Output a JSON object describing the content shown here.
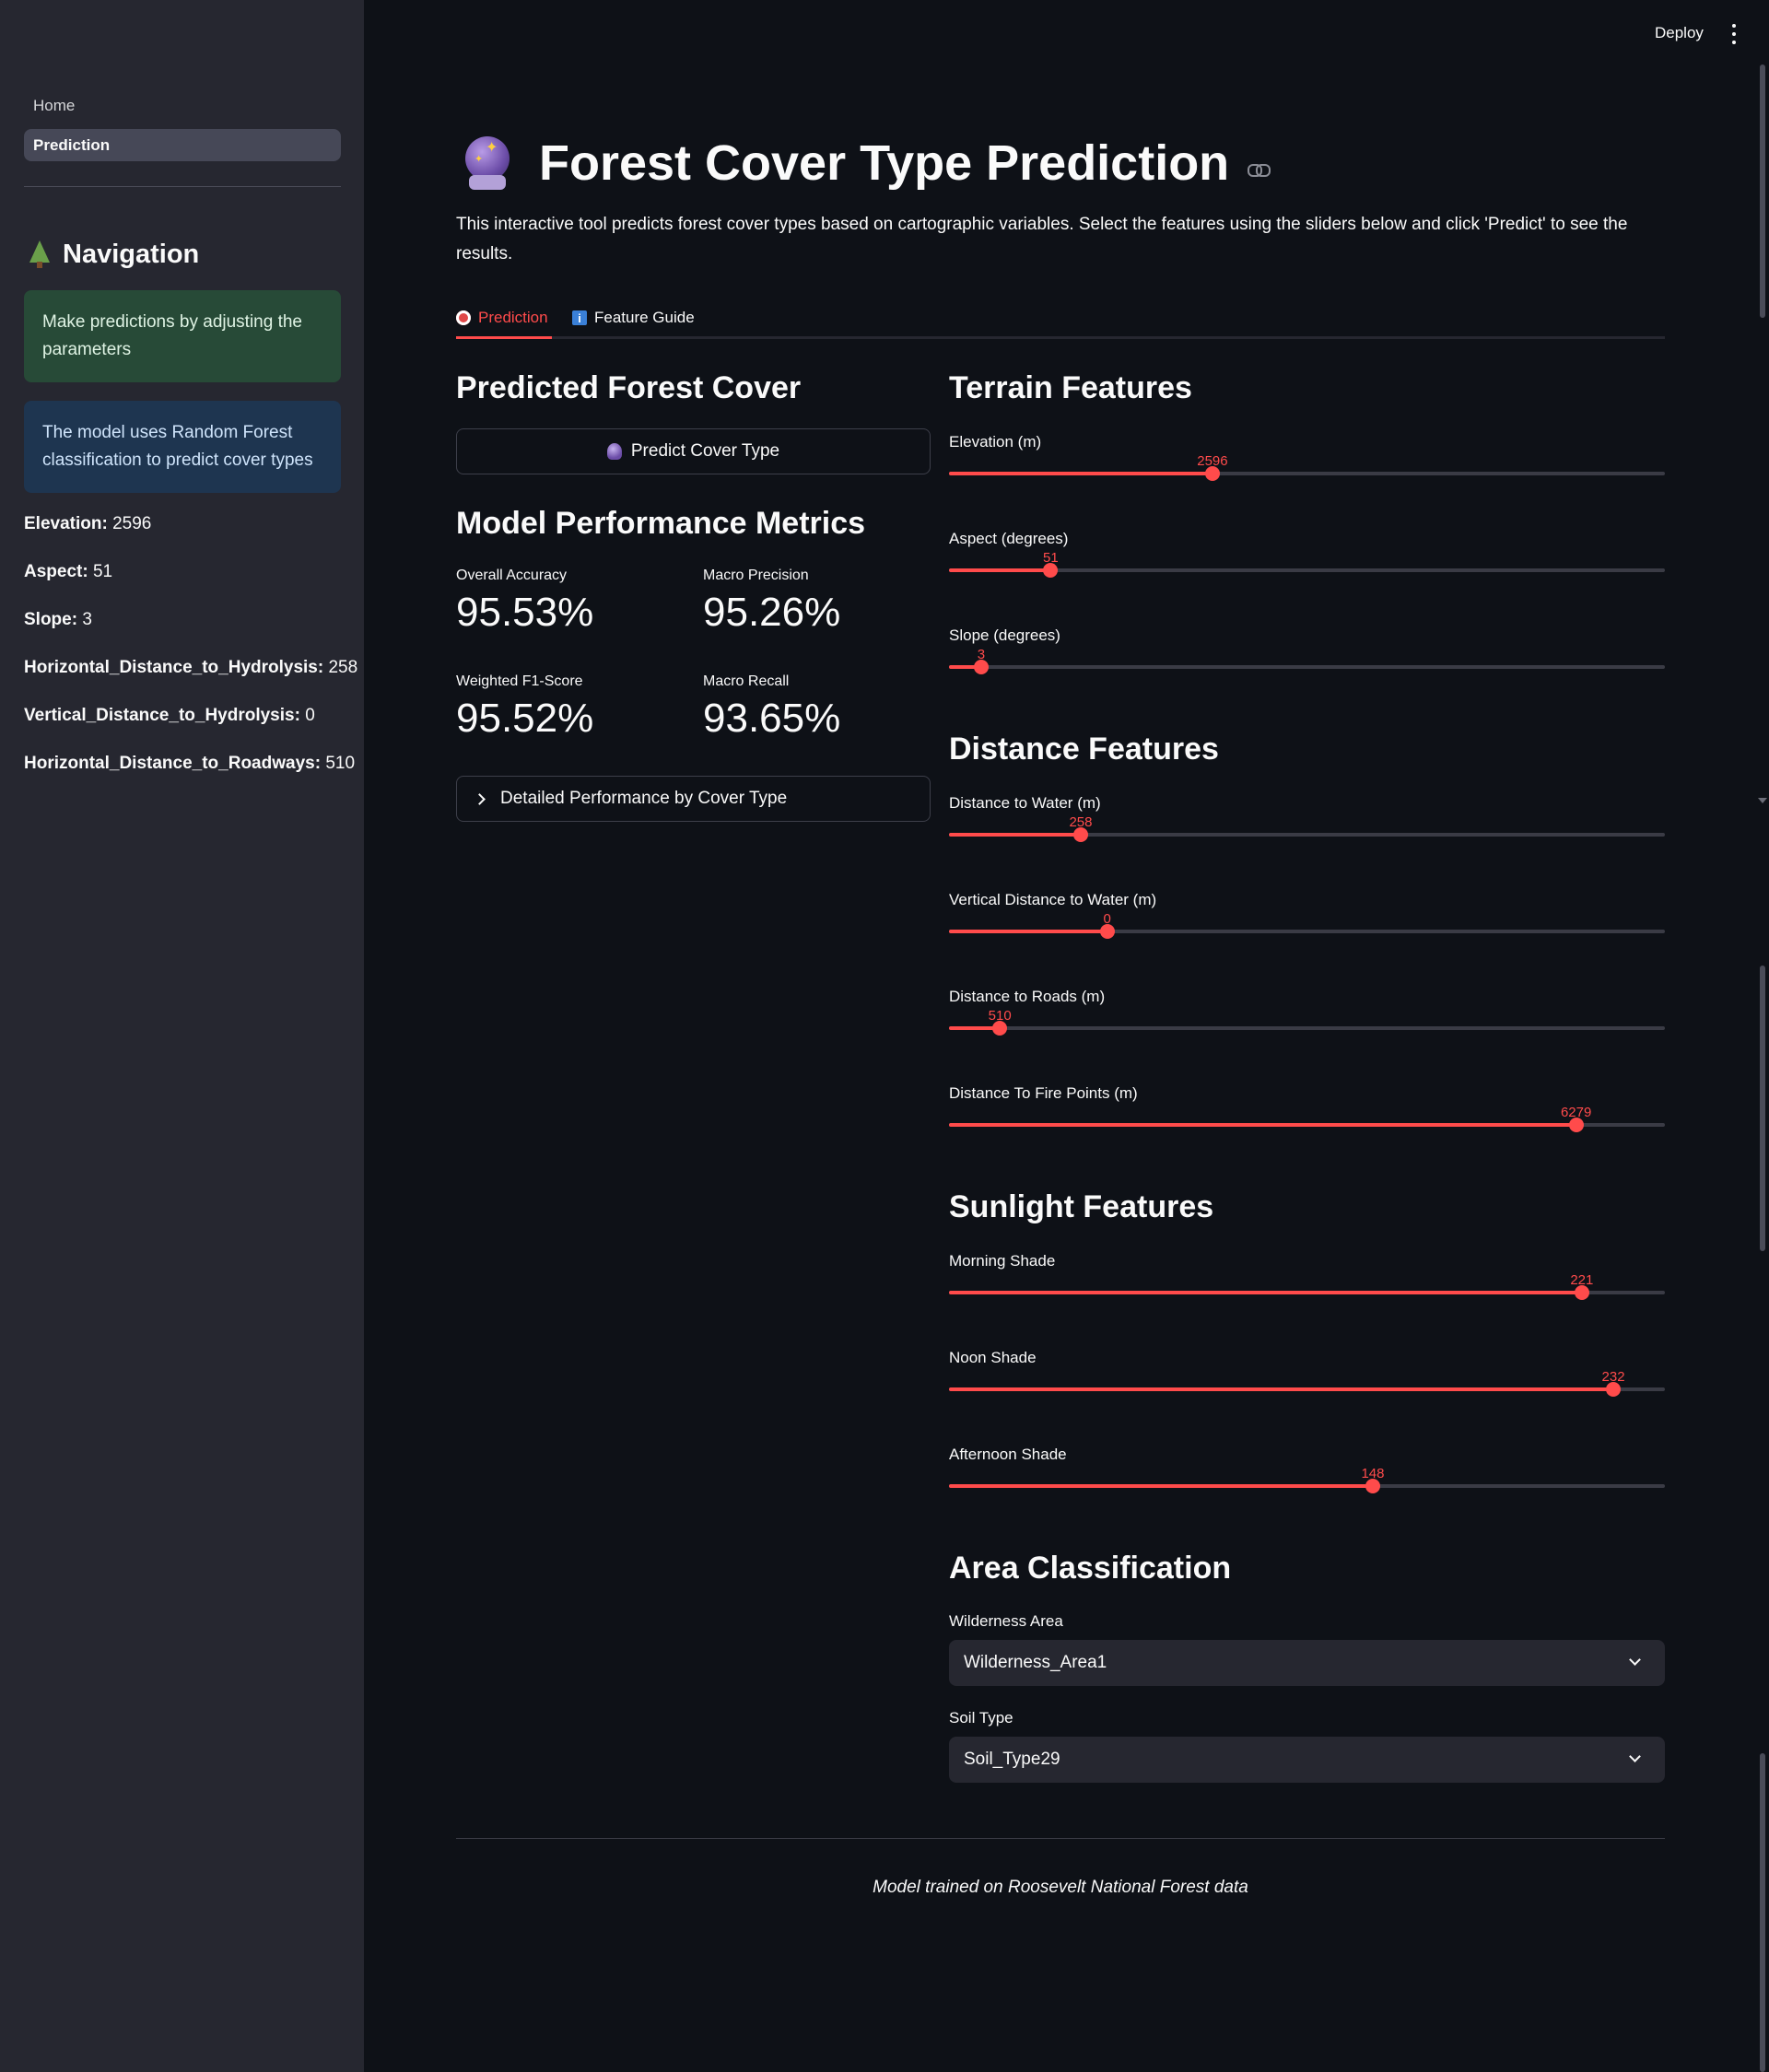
{
  "sidebar": {
    "pages": [
      "Home",
      "Prediction"
    ],
    "header": "Navigation",
    "success_msg": "Make predictions by adjusting the parameters",
    "info_msg": "The model uses Random Forest classification to predict cover types",
    "stats": [
      {
        "key": "Elevation:",
        "value": "2596"
      },
      {
        "key": "Aspect:",
        "value": "51"
      },
      {
        "key": "Slope:",
        "value": "3"
      },
      {
        "key": "Horizontal_Distance_to_Hydrolysis:",
        "value": "258"
      },
      {
        "key": "Vertical_Distance_to_Hydrolysis:",
        "value": "0"
      },
      {
        "key": "Horizontal_Distance_to_Roadways:",
        "value": "510"
      }
    ]
  },
  "topbar": {
    "deploy": "Deploy"
  },
  "main": {
    "title": "Forest Cover Type Prediction",
    "intro": "This interactive tool predicts forest cover types based on cartographic variables. Select the features using the sliders below and click 'Predict' to see the results.",
    "tabs": [
      "Prediction",
      "Feature Guide"
    ],
    "predicted_heading": "Predicted Forest Cover",
    "predict_button": "Predict Cover Type",
    "metrics_heading": "Model Performance Metrics",
    "metrics": [
      {
        "label": "Overall Accuracy",
        "value": "95.53%"
      },
      {
        "label": "Macro Precision",
        "value": "95.26%"
      },
      {
        "label": "Weighted F1-Score",
        "value": "95.52%"
      },
      {
        "label": "Macro Recall",
        "value": "93.65%"
      }
    ],
    "expander": "Detailed Performance by Cover Type",
    "sections": {
      "terrain": "Terrain Features",
      "distance": "Distance Features",
      "sunlight": "Sunlight Features",
      "area": "Area Classification"
    },
    "sliders": [
      {
        "label": "Elevation (m)",
        "value": "2596",
        "fraction": 0.368
      },
      {
        "label": "Aspect (degrees)",
        "value": "51",
        "fraction": 0.142
      },
      {
        "label": "Slope (degrees)",
        "value": "3",
        "fraction": 0.045
      },
      {
        "label": "Distance to Water (m)",
        "value": "258",
        "fraction": 0.184
      },
      {
        "label": "Vertical Distance to Water (m)",
        "value": "0",
        "fraction": 0.221
      },
      {
        "label": "Distance to Roads (m)",
        "value": "510",
        "fraction": 0.071
      },
      {
        "label": "Distance To Fire Points (m)",
        "value": "6279",
        "fraction": 0.876
      },
      {
        "label": "Morning Shade",
        "value": "221",
        "fraction": 0.884
      },
      {
        "label": "Noon Shade",
        "value": "232",
        "fraction": 0.928
      },
      {
        "label": "Afternoon Shade",
        "value": "148",
        "fraction": 0.592
      }
    ],
    "wilderness_label": "Wilderness Area",
    "wilderness_value": "Wilderness_Area1",
    "soil_label": "Soil Type",
    "soil_value": "Soil_Type29",
    "footer": "Model trained on Roosevelt National Forest data"
  },
  "colors": {
    "accent": "#ff4b4b",
    "background": "#0e1117",
    "sidebar": "#262730"
  }
}
